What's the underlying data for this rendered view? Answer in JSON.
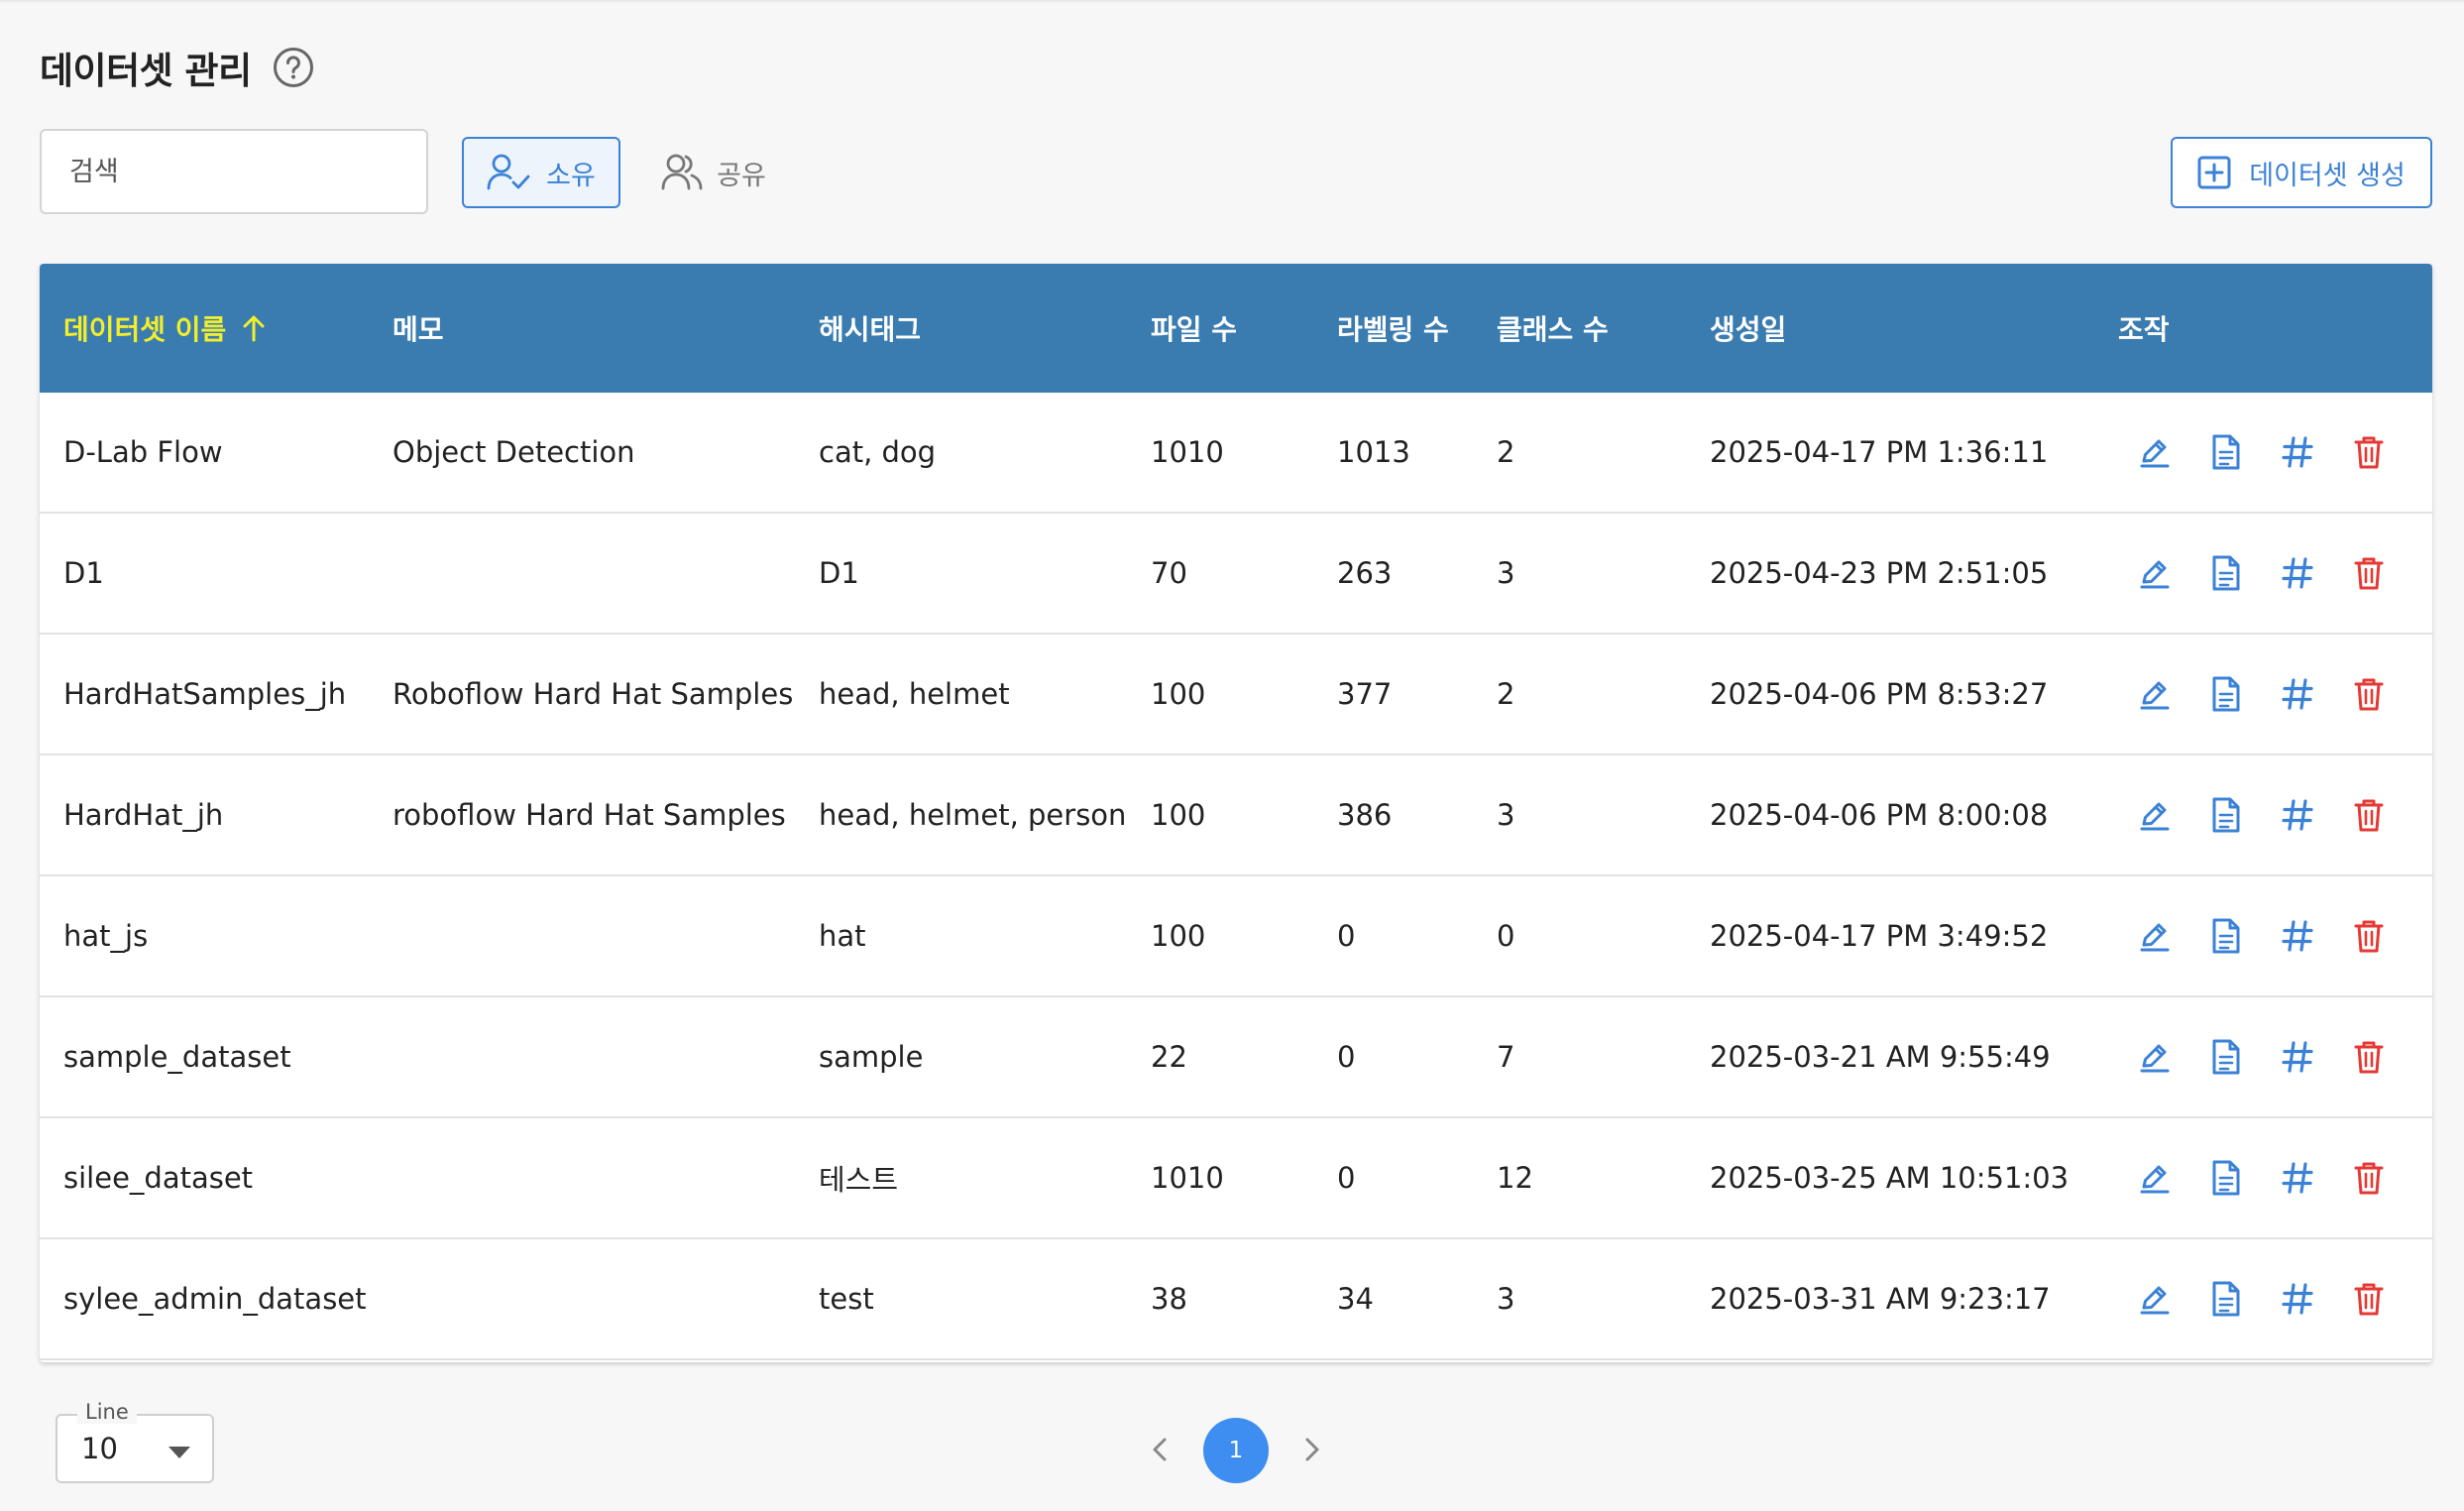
{
  "page": {
    "title": "데이터셋 관리",
    "help_icon": "question-circle-icon"
  },
  "toolbar": {
    "search_placeholder": "검색",
    "search_value": "",
    "filter_own_label": "소유",
    "filter_shared_label": "공유",
    "create_label": "데이터셋 생성"
  },
  "colors": {
    "header_bg": "#3a7cb0",
    "sorted_header_text": "#f2ee2c",
    "accent": "#3b82d6",
    "delete": "#e53935",
    "active_page": "#3d8ef0"
  },
  "table": {
    "headers": {
      "name": "데이터셋 이름",
      "memo": "메모",
      "hashtag": "해시태그",
      "files": "파일 수",
      "labels": "라벨링 수",
      "classes": "클래스 수",
      "created": "생성일",
      "actions": "조작"
    },
    "sort": {
      "column": "name",
      "direction": "ascending"
    },
    "row_actions": [
      "edit-icon",
      "document-icon",
      "hashtag-icon",
      "trash-icon"
    ],
    "rows": [
      {
        "name": "D-Lab Flow",
        "memo": "Object Detection",
        "hashtag": "cat, dog",
        "files": "1010",
        "labels": "1013",
        "classes": "2",
        "created": "2025-04-17 PM 1:36:11"
      },
      {
        "name": "D1",
        "memo": "",
        "hashtag": "D1",
        "files": "70",
        "labels": "263",
        "classes": "3",
        "created": "2025-04-23 PM 2:51:05"
      },
      {
        "name": "HardHatSamples_jh",
        "memo": "Roboflow Hard Hat Samples",
        "hashtag": "head, helmet",
        "files": "100",
        "labels": "377",
        "classes": "2",
        "created": "2025-04-06 PM 8:53:27"
      },
      {
        "name": "HardHat_jh",
        "memo": "roboflow Hard Hat Samples",
        "hashtag": "head, helmet, person",
        "files": "100",
        "labels": "386",
        "classes": "3",
        "created": "2025-04-06 PM 8:00:08"
      },
      {
        "name": "hat_js",
        "memo": "",
        "hashtag": "hat",
        "files": "100",
        "labels": "0",
        "classes": "0",
        "created": "2025-04-17 PM 3:49:52"
      },
      {
        "name": "sample_dataset",
        "memo": "",
        "hashtag": "sample",
        "files": "22",
        "labels": "0",
        "classes": "7",
        "created": "2025-03-21 AM 9:55:49"
      },
      {
        "name": "silee_dataset",
        "memo": "",
        "hashtag": "테스트",
        "files": "1010",
        "labels": "0",
        "classes": "12",
        "created": "2025-03-25 AM 10:51:03"
      },
      {
        "name": "sylee_admin_dataset",
        "memo": "",
        "hashtag": "test",
        "files": "38",
        "labels": "34",
        "classes": "3",
        "created": "2025-03-31 AM 9:23:17"
      }
    ]
  },
  "footer": {
    "line_label": "Line",
    "line_value": "10",
    "current_page": "1"
  }
}
